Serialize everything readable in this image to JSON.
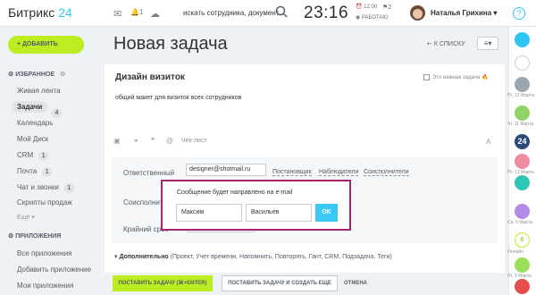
{
  "header": {
    "logo_main": "Битрикс",
    "logo_num": "24",
    "notif_count": "1",
    "search_text": "искать сотрудника, документ",
    "clock": "23:16",
    "alarm": "12:00",
    "work_status": "РАБОТАЮ",
    "flag_count": "2",
    "user_name": "Наталья Грихина",
    "help": "?"
  },
  "sidebar": {
    "add_button": "+ ДОБАВИТЬ",
    "favorites_title": "ИЗБРАННОЕ",
    "items": [
      "Живая лента",
      "Задачи",
      "Календарь",
      "Мой Диск",
      "CRM",
      "Почта",
      "Чат и звонки",
      "Скрипты продаж",
      "Ещё"
    ],
    "counts": {
      "tasks": "4",
      "crm": "1",
      "mail": "1",
      "chat": "1"
    },
    "apps_title": "ПРИЛОЖЕНИЯ",
    "app_items": [
      "Все приложения",
      "Добавить приложение",
      "Мои приложения"
    ]
  },
  "page": {
    "title": "Новая задача",
    "back_to_list": "К СПИСКУ",
    "view_icon": "≡▾"
  },
  "task": {
    "name": "Дизайн визиток",
    "important": "Это важная задача",
    "description": "общий макет для визиток всех сотрудников",
    "checklist": "Чек-лист"
  },
  "fields": {
    "responsible_label": "Ответственный",
    "responsible_value": "designer@shotmail.ru",
    "links": [
      "Постановщик",
      "Наблюдатели",
      "Соисполнители"
    ],
    "coexec_label": "Соисполнители",
    "deadline_label": "Крайний срок"
  },
  "more": {
    "label": "Дополнительно",
    "list": "(Проект, Учет времени, Напомнить, Повторять, Гант, CRM, Подзадача, Теги)"
  },
  "buttons": {
    "submit": "ПОСТАВИТЬ ЗАДАЧУ (⌘+ENTER)",
    "create_more": "ПОСТАВИТЬ ЗАДАЧУ И СОЗДАТЬ ЕЩЕ",
    "cancel": "ОТМЕНА"
  },
  "popup": {
    "title": "Сообщение будет направлено на e-mail",
    "first_name": "Максим",
    "last_name": "Васильев",
    "ok": "OK"
  },
  "rightbar": {
    "dates": [
      "Пт, 12 Марта",
      "Чт, 11 Марта",
      "Пт, 12 Марта",
      "Ср, 9 Марта",
      "Пт, 5 Марта"
    ],
    "online_label": "Онлайн",
    "online_count": "6",
    "center_badge": "24"
  },
  "colors": {
    "accent_green": "#bbed21",
    "accent_blue": "#2fc6f6",
    "popup_border": "#a8226e"
  }
}
